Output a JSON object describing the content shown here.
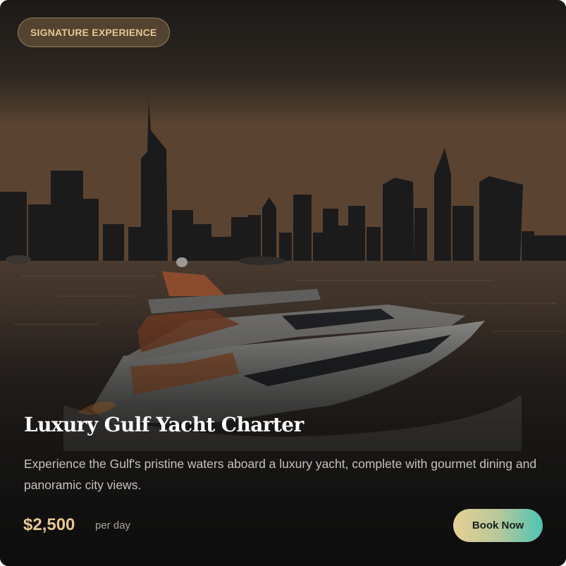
{
  "card": {
    "badge": "SIGNATURE EXPERIENCE",
    "title": "Luxury Gulf Yacht Charter",
    "description": "Experience the Gulf's pristine waters aboard a luxury yacht, complete with gourmet dining and panoramic city views.",
    "price": "$2,500",
    "price_unit": "per day",
    "cta_label": "Book Now"
  },
  "colors": {
    "accent_gold": "#e6c68f",
    "cta_gradient_start": "#e6cf94",
    "cta_gradient_end": "#4ec4b4",
    "overlay": "#1d1a18"
  },
  "image": {
    "subject": "yacht-cruising-past-city-skyline-at-dusk"
  }
}
